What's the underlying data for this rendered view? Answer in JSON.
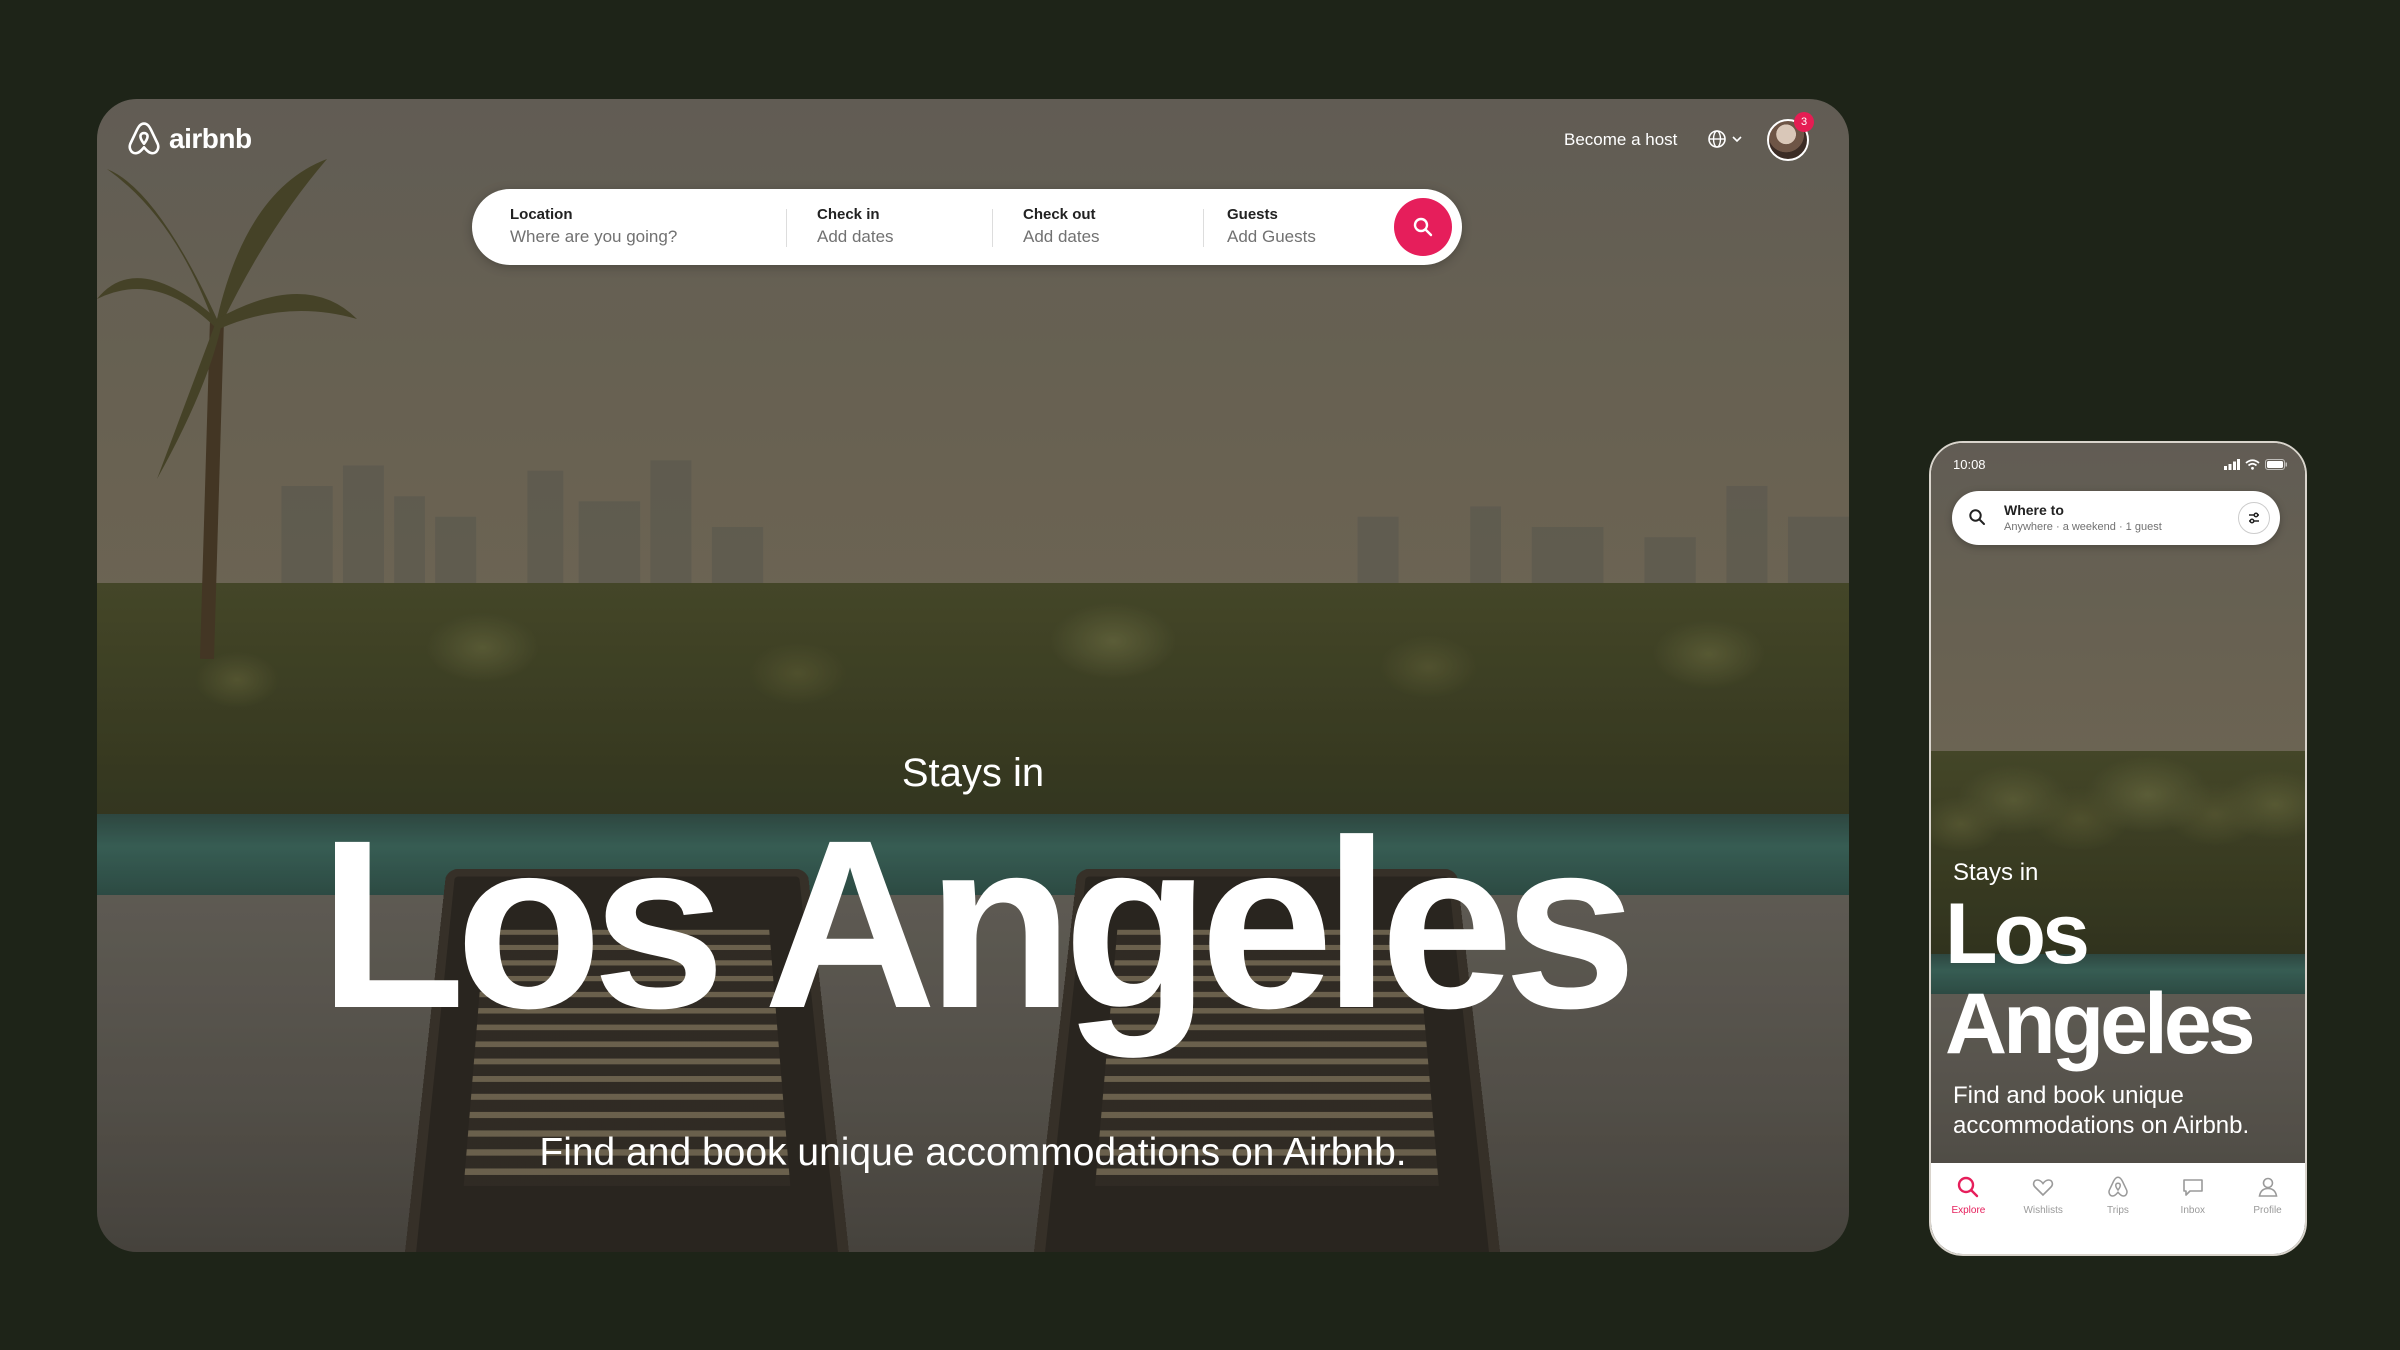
{
  "desktop": {
    "logo_text": "airbnb",
    "become_host": "Become a host",
    "notification_count": "3",
    "search": {
      "location_label": "Location",
      "location_placeholder": "Where are you going?",
      "checkin_label": "Check in",
      "checkin_placeholder": "Add dates",
      "checkout_label": "Check out",
      "checkout_placeholder": "Add dates",
      "guests_label": "Guests",
      "guests_placeholder": "Add Guests"
    },
    "hero": {
      "kicker": "Stays in",
      "city": "Los Angeles",
      "tagline": "Find and book unique accommodations on Airbnb."
    }
  },
  "phone": {
    "time": "10:08",
    "search": {
      "title": "Where to",
      "subtitle": "Anywhere · a weekend · 1 guest"
    },
    "hero": {
      "kicker": "Stays in",
      "city_line1": "Los",
      "city_line2": "Angeles",
      "tagline": "Find and book unique accommodations on Airbnb."
    },
    "nav": [
      {
        "label": "Explore",
        "icon": "search-icon"
      },
      {
        "label": "Wishlists",
        "icon": "heart-icon"
      },
      {
        "label": "Trips",
        "icon": "airbnb-logo-icon"
      },
      {
        "label": "Inbox",
        "icon": "message-icon"
      },
      {
        "label": "Profile",
        "icon": "user-icon"
      }
    ]
  },
  "colors": {
    "brand": "#e61e5b",
    "background": "#1e2418"
  }
}
